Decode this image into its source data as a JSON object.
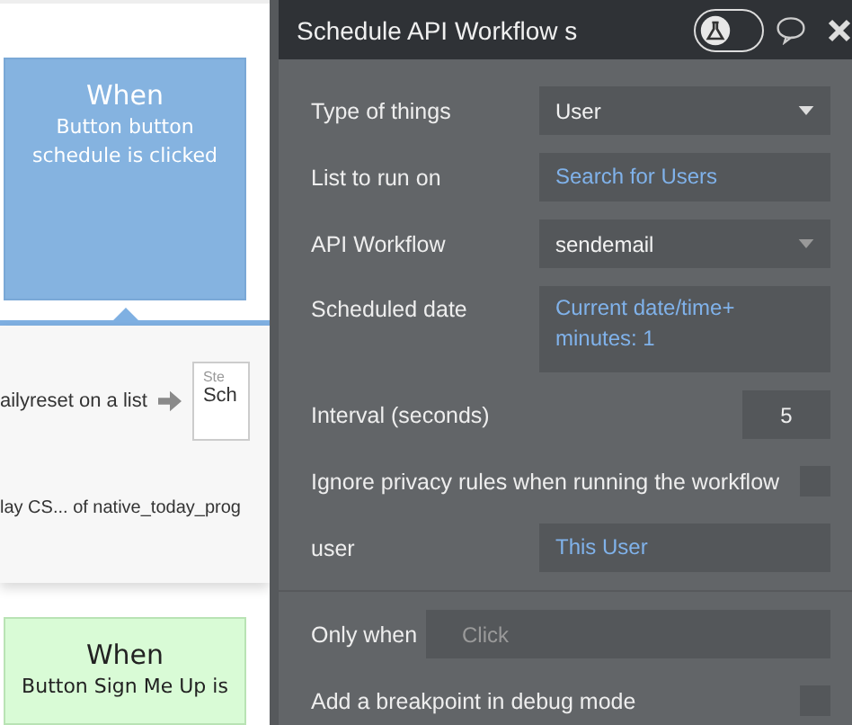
{
  "canvas": {
    "top_card": {
      "title": "When",
      "text": "Button button schedule is clicked"
    },
    "action_row": {
      "text": "ailyreset on a list",
      "step_label": "Ste",
      "step_title": "Sch"
    },
    "detail_text": "lay CS... of native_today_prog",
    "bottom_card": {
      "title": "When",
      "text": "Button Sign Me Up is"
    }
  },
  "panel": {
    "title": "Schedule API Workflow s",
    "debug_toggle": {
      "on": false
    },
    "fields": [
      {
        "kind": "dropdown",
        "label": "Type of things",
        "value": "User"
      },
      {
        "kind": "expression",
        "label": "List to run on",
        "value": "Search for Users"
      },
      {
        "kind": "dropdown",
        "label": "API Workflow",
        "value": "sendemail"
      },
      {
        "kind": "expression",
        "label": "Scheduled date",
        "value": "Current date/time+ minutes: 1"
      },
      {
        "kind": "number",
        "label": "Interval (seconds)",
        "value": "5"
      },
      {
        "kind": "checkbox",
        "label": "Ignore privacy rules when running the workflow",
        "checked": false
      },
      {
        "kind": "expression",
        "label": "user",
        "value": "This User"
      }
    ],
    "only_when": {
      "label": "Only when",
      "placeholder": "Click"
    },
    "breakpoint": {
      "label": "Add a breakpoint in debug mode",
      "checked": false
    }
  }
}
